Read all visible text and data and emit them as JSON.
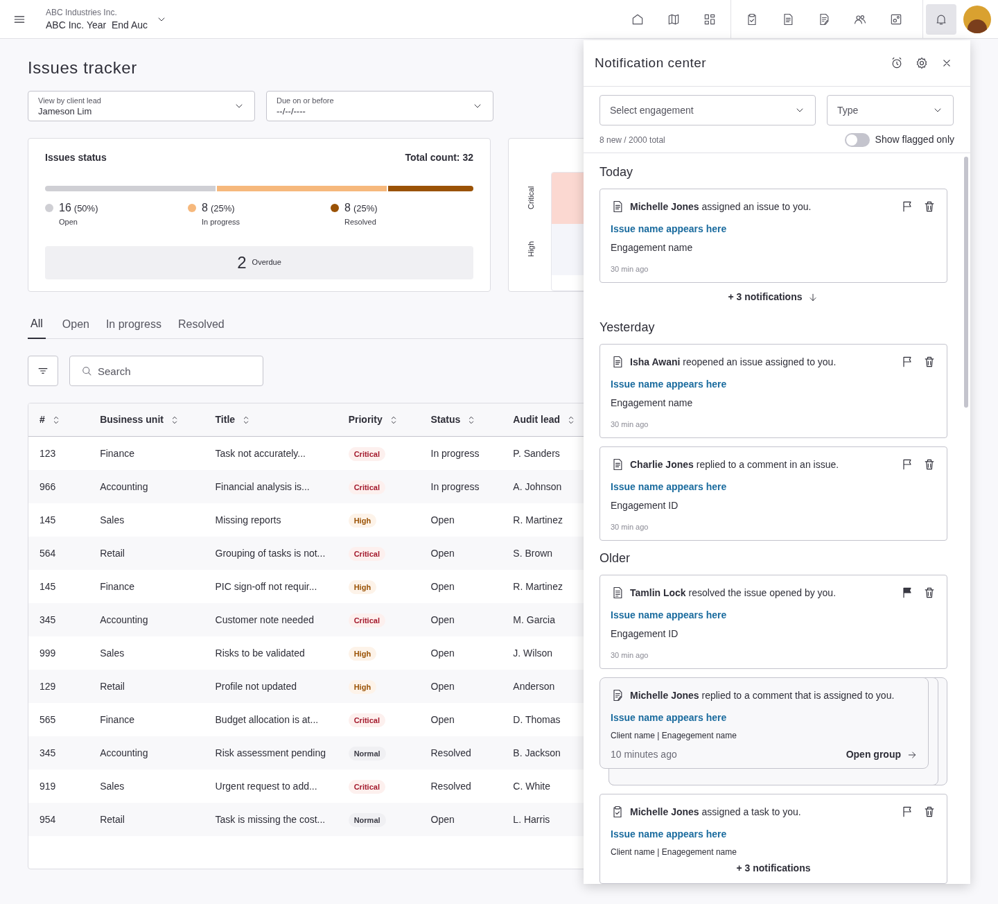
{
  "header": {
    "company": "ABC Industries Inc.",
    "engagement": "ABC Inc. Year  End Auc"
  },
  "page_title": "Issues tracker",
  "filters": [
    {
      "label": "View by client lead",
      "value": "Jameson Lim"
    },
    {
      "label": "Due on or before",
      "value": "--/--/----"
    }
  ],
  "status_card": {
    "title": "Issues status",
    "total": "Total count: 32",
    "segments": [
      {
        "count": "16",
        "pct": "(50%)",
        "label": "Open",
        "color": "#cfcfd4"
      },
      {
        "count": "8",
        "pct": "(25%)",
        "label": "In progress",
        "color": "#f6b87c"
      },
      {
        "count": "8",
        "pct": "(25%)",
        "label": "Resolved",
        "color": "#9a5205"
      }
    ],
    "overdue_count": "2",
    "overdue_label": "Overdue"
  },
  "priority_chart": {
    "labels": [
      "Critical",
      "High"
    ]
  },
  "tabs": [
    {
      "label": "All",
      "selected": true
    },
    {
      "label": "Open",
      "selected": false
    },
    {
      "label": "In progress",
      "selected": false
    },
    {
      "label": "Resolved",
      "selected": false
    }
  ],
  "search": {
    "placeholder": "Search"
  },
  "table": {
    "columns": [
      "#",
      "Business unit",
      "Title",
      "Priority",
      "Status",
      "Audit lead"
    ],
    "rows": [
      {
        "number": "123",
        "unit": "Finance",
        "title": "Task not accurately...",
        "priority": {
          "text": "Critical",
          "kind": "critical"
        },
        "status": "In progress",
        "lead": "P. Sanders"
      },
      {
        "number": "966",
        "unit": "Accounting",
        "title": "Financial analysis is...",
        "priority": {
          "text": "Critical",
          "kind": "critical"
        },
        "status": "In progress",
        "lead": "A. Johnson"
      },
      {
        "number": "145",
        "unit": "Sales",
        "title": "Missing reports",
        "priority": {
          "text": "High",
          "kind": "high"
        },
        "status": "Open",
        "lead": "R. Martinez"
      },
      {
        "number": "564",
        "unit": "Retail",
        "title": "Grouping of tasks is not...",
        "priority": {
          "text": "Critical",
          "kind": "critical"
        },
        "status": "Open",
        "lead": "S. Brown"
      },
      {
        "number": "145",
        "unit": "Finance",
        "title": "PIC sign-off not requir...",
        "priority": {
          "text": "High",
          "kind": "high"
        },
        "status": "Open",
        "lead": "R. Martinez"
      },
      {
        "number": "345",
        "unit": "Accounting",
        "title": "Customer note needed",
        "priority": {
          "text": "Critical",
          "kind": "critical"
        },
        "status": "Open",
        "lead": "M. Garcia"
      },
      {
        "number": "999",
        "unit": "Sales",
        "title": "Risks to be validated",
        "priority": {
          "text": "High",
          "kind": "high"
        },
        "status": "Open",
        "lead": "J. Wilson"
      },
      {
        "number": "129",
        "unit": "Retail",
        "title": "Profile not updated",
        "priority": {
          "text": "High",
          "kind": "high"
        },
        "status": "Open",
        "lead": "Anderson"
      },
      {
        "number": "565",
        "unit": "Finance",
        "title": "Budget allocation is at...",
        "priority": {
          "text": "Critical",
          "kind": "critical"
        },
        "status": "Open",
        "lead": "D. Thomas"
      },
      {
        "number": "345",
        "unit": "Accounting",
        "title": "Risk assessment pending",
        "priority": {
          "text": "Normal",
          "kind": "normal"
        },
        "status": "Resolved",
        "lead": "B. Jackson"
      },
      {
        "number": "919",
        "unit": "Sales",
        "title": "Urgent request to add...",
        "priority": {
          "text": "Critical",
          "kind": "critical"
        },
        "status": "Resolved",
        "lead": "C. White"
      },
      {
        "number": "954",
        "unit": "Retail",
        "title": "Task is missing the cost...",
        "priority": {
          "text": "Normal",
          "kind": "normal"
        },
        "status": "Open",
        "lead": "L. Harris"
      }
    ]
  },
  "notification_center": {
    "title": "Notification center",
    "engagement_select": {
      "placeholder": "Select engagement"
    },
    "type_select": {
      "placeholder": "Type"
    },
    "count": "8 new / 2000 total",
    "flagged_toggle": {
      "label": "Show flagged only",
      "on": false
    },
    "groups": [
      {
        "heading": "Today",
        "items": [
          {
            "kind": "single",
            "text": "**Michelle Jones** assigned an issue to you.",
            "link": "Issue name appears here",
            "meta": "Engagement name",
            "time": "30 min ago",
            "flagged": false
          }
        ],
        "more": "+ 3 notifications"
      },
      {
        "heading": "Yesterday",
        "items": [
          {
            "kind": "single",
            "text": "**Isha Awani** reopened an issue assigned to you.",
            "link": "Issue name appears here",
            "meta": "Engagement name",
            "time": "30 min ago",
            "flagged": false
          },
          {
            "kind": "single",
            "text": "**Charlie Jones** replied to a comment in an issue.",
            "link": "Issue name appears here",
            "meta": "Engagement ID",
            "time": "30 min ago",
            "flagged": false
          }
        ]
      },
      {
        "heading": "Older",
        "items": [
          {
            "kind": "single",
            "text": "**Tamlin Lock** resolved the issue opened by you.",
            "link": "Issue name appears here",
            "meta": "Engagement ID",
            "time": "30 min ago",
            "flagged": true
          },
          {
            "kind": "group",
            "text": "**Michelle Jones** replied to a comment that is assigned to you.",
            "link": "Issue name appears here",
            "meta": "Client name | Enagegement name",
            "time": "10 minutes ago",
            "action": "Open group"
          },
          {
            "kind": "task",
            "text": "**Michelle Jones** assigned a task to you.",
            "link": "Issue name appears here",
            "meta": "Client name | Enagegement name",
            "more": "+ 3 notifications",
            "flagged": false
          }
        ]
      }
    ]
  }
}
